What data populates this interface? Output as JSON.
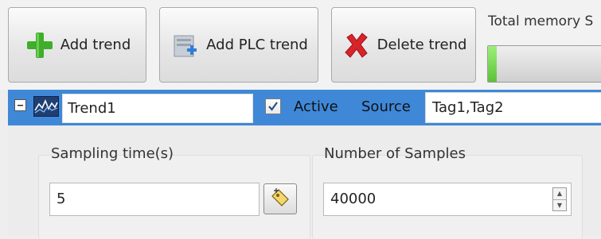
{
  "toolbar": {
    "add_trend_label": "Add trend",
    "add_plc_trend_label": "Add PLC trend",
    "delete_trend_label": "Delete trend",
    "memory_label": "Total memory S",
    "memory_usage_fraction": 0.07
  },
  "trend": {
    "name": "Trend1",
    "active_label": "Active",
    "active_checked": true,
    "source_label": "Source",
    "source_value": "Tag1,Tag2"
  },
  "settings": {
    "sampling_time_label": "Sampling time(s)",
    "sampling_time_value": "5",
    "num_samples_label": "Number of Samples",
    "num_samples_value": "40000"
  },
  "colors": {
    "selection_row": "#3f88d8",
    "add_icon": "#3fae2a",
    "delete_icon": "#d9232a"
  },
  "icons": {
    "add_trend": "plus-icon",
    "add_plc_trend": "plc-add-icon",
    "delete_trend": "delete-x-icon",
    "trend": "trend-chart-icon",
    "tag_browse": "tag-icon"
  }
}
